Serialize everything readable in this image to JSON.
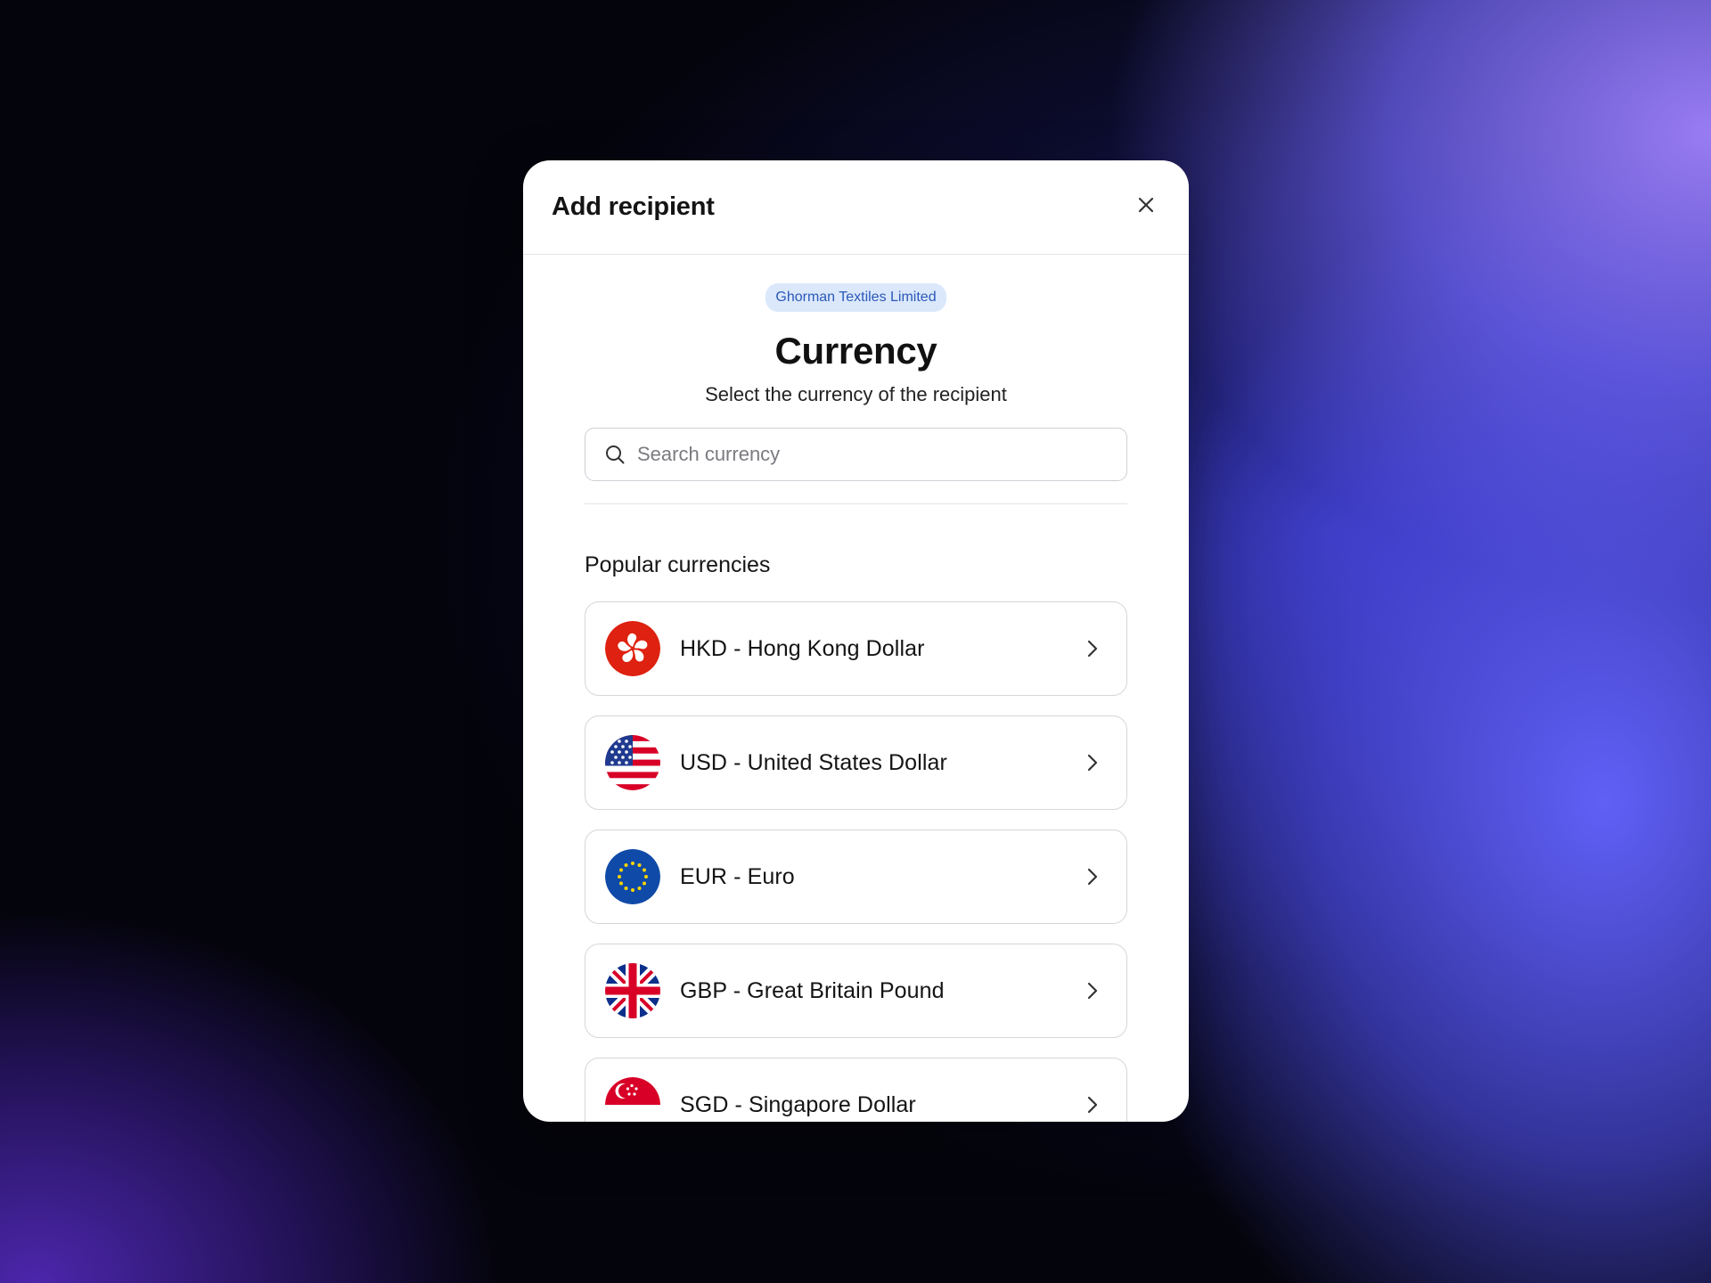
{
  "modal": {
    "title": "Add recipient"
  },
  "badge": {
    "company": "Ghorman Textiles Limited",
    "background": "#dbe8fb",
    "color": "#2a58b8"
  },
  "heading": {
    "title": "Currency",
    "subtitle": "Select the currency of the recipient"
  },
  "search": {
    "placeholder": "Search currency",
    "value": "",
    "icon": "search-icon"
  },
  "popular": {
    "label": "Popular currencies",
    "items": [
      {
        "code": "HKD",
        "label": "HKD - Hong Kong Dollar",
        "flag": "hong-kong-flag-icon"
      },
      {
        "code": "USD",
        "label": "USD - United States Dollar",
        "flag": "united-states-flag-icon"
      },
      {
        "code": "EUR",
        "label": "EUR - Euro",
        "flag": "european-union-flag-icon"
      },
      {
        "code": "GBP",
        "label": "GBP - Great Britain Pound",
        "flag": "united-kingdom-flag-icon"
      },
      {
        "code": "SGD",
        "label": "SGD - Singapore Dollar",
        "flag": "singapore-flag-icon"
      }
    ]
  },
  "icons": {
    "close": "close-icon",
    "chevron": "chevron-right-icon"
  }
}
